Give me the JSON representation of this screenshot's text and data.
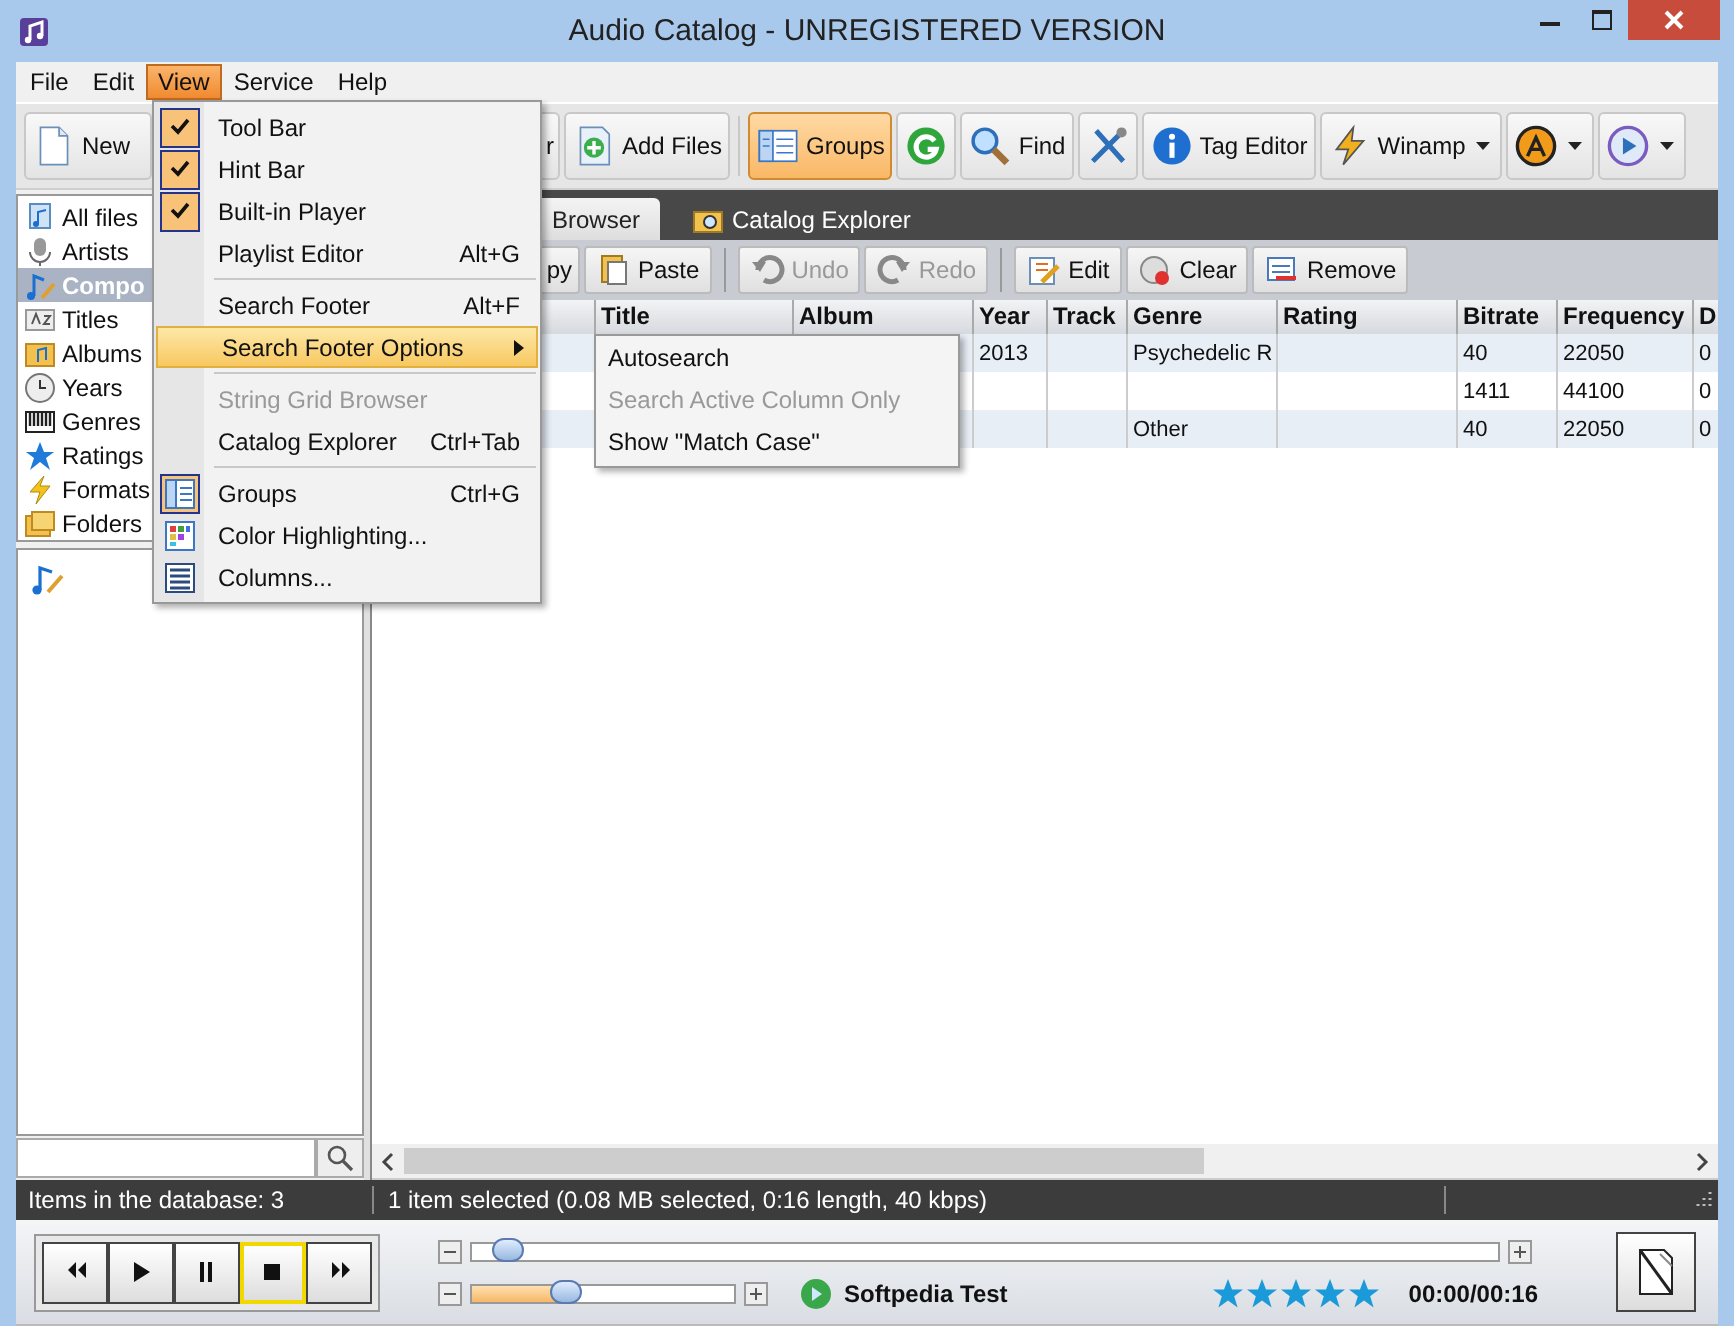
{
  "window": {
    "title": "Audio Catalog - UNREGISTERED VERSION"
  },
  "menu_bar": [
    {
      "label": "File",
      "selected": false
    },
    {
      "label": "Edit",
      "selected": false
    },
    {
      "label": "View",
      "selected": true
    },
    {
      "label": "Service",
      "selected": false
    },
    {
      "label": "Help",
      "selected": false
    }
  ],
  "toolbar": [
    {
      "label": "New",
      "selected": false
    },
    {
      "label": "r",
      "selected": false
    },
    {
      "label": "Add Files",
      "selected": false
    },
    {
      "label": "Groups",
      "selected": true
    },
    {
      "selected": false
    },
    {
      "label": "Find",
      "selected": false
    },
    {
      "selected": false
    },
    {
      "label": "Tag Editor",
      "selected": false
    },
    {
      "label": "Winamp",
      "selected": false,
      "dropdown": true
    },
    {
      "selected": false,
      "dropdown": true
    },
    {
      "selected": false,
      "dropdown": true
    }
  ],
  "sidebar": {
    "items": [
      {
        "label": "All files",
        "selected": false
      },
      {
        "label": "Artists",
        "selected": false
      },
      {
        "label": "Compo",
        "selected": true
      },
      {
        "label": "Titles",
        "selected": false
      },
      {
        "label": "Albums",
        "selected": false
      },
      {
        "label": "Years",
        "selected": false
      },
      {
        "label": "Genres",
        "selected": false
      },
      {
        "label": "Ratings",
        "selected": false
      },
      {
        "label": "Formats",
        "selected": false
      },
      {
        "label": "Folders",
        "selected": false
      }
    ]
  },
  "tabs": [
    {
      "label": "Browser",
      "selected": true
    },
    {
      "label": "Catalog Explorer",
      "selected": false
    }
  ],
  "edit_toolbar": [
    {
      "label": "py",
      "disabled": false,
      "separator_before": false
    },
    {
      "label": "Paste",
      "disabled": false,
      "separator_before": false
    },
    {
      "label": "Undo",
      "disabled": true,
      "separator_before": true
    },
    {
      "label": "Redo",
      "disabled": true,
      "separator_before": false
    },
    {
      "label": "Edit",
      "disabled": false,
      "separator_before": true
    },
    {
      "label": "Clear",
      "disabled": false,
      "separator_before": false
    },
    {
      "label": "Remove",
      "disabled": false,
      "separator_before": false
    }
  ],
  "table": {
    "columns": [
      "Title",
      "Album",
      "Year",
      "Track",
      "Genre",
      "Rating",
      "Bitrate",
      "Frequency",
      "D"
    ],
    "rows": [
      [
        null,
        null,
        "2013",
        null,
        "Psychedelic R",
        null,
        "40",
        "22050",
        "0"
      ],
      [
        null,
        null,
        null,
        null,
        null,
        null,
        "1411",
        "44100",
        "0"
      ],
      [
        null,
        null,
        null,
        null,
        "Other",
        null,
        "40",
        "22050",
        "0"
      ]
    ]
  },
  "view_menu": [
    {
      "kind": "check",
      "label": "Tool Bar",
      "checked": true
    },
    {
      "kind": "check",
      "label": "Hint Bar",
      "checked": true
    },
    {
      "kind": "check",
      "label": "Built-in Player",
      "checked": true
    },
    {
      "kind": "check",
      "label": "Playlist Editor",
      "checked": false,
      "shortcut": "Alt+G"
    },
    {
      "kind": "separator"
    },
    {
      "kind": "plain",
      "label": "Search Footer",
      "shortcut": "Alt+F"
    },
    {
      "kind": "plain",
      "label": "Search Footer Options",
      "submenu": true,
      "selected": true
    },
    {
      "kind": "separator"
    },
    {
      "kind": "plain",
      "label": "String Grid Browser",
      "disabled": true
    },
    {
      "kind": "plain",
      "label": "Catalog Explorer",
      "shortcut": "Ctrl+Tab"
    },
    {
      "kind": "separator"
    },
    {
      "kind": "icon",
      "label": "Groups",
      "shortcut": "Ctrl+G",
      "checked": true
    },
    {
      "kind": "icon",
      "label": "Color Highlighting...",
      "checked": false
    },
    {
      "kind": "icon",
      "label": "Columns...",
      "checked": false
    }
  ],
  "submenu": [
    {
      "label": "Autosearch",
      "disabled": false
    },
    {
      "label": "Search Active Column Only",
      "disabled": true
    },
    {
      "label": "Show \"Match Case\"",
      "disabled": false
    }
  ],
  "status_bar": {
    "count": "Items in the database: 3",
    "selection": "1 item selected (0.08 MB selected, 0:16 length, 40 kbps)"
  },
  "player": {
    "buttons": [
      {
        "selected": false
      },
      {
        "selected": false
      },
      {
        "selected": false
      },
      {
        "selected": true
      },
      {
        "selected": false
      }
    ],
    "position": {
      "level": 0.02
    },
    "volume": {
      "level": 0.36
    },
    "track": "Softpedia Test",
    "stars": 5,
    "time": "00:00/00:16"
  }
}
